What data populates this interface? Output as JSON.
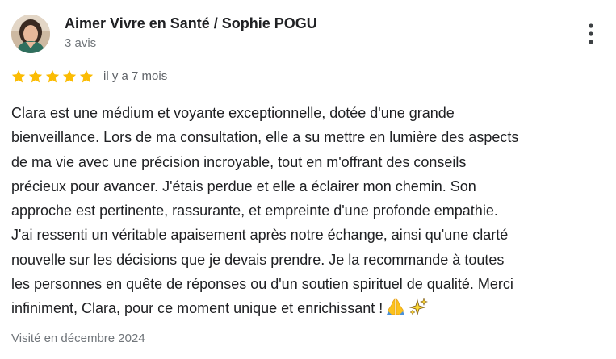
{
  "review": {
    "author": {
      "name": "Aimer Vivre en Santé / Sophie POGU",
      "review_count": "3 avis",
      "avatar_icon": "profile-photo"
    },
    "more_icon": "more-vert-icon",
    "rating": {
      "stars": 5,
      "max": 5,
      "color": "#fbbc04"
    },
    "time_ago": "il y a 7 mois",
    "text_lines": [
      "Clara est une médium et voyante exceptionnelle, dotée d'une grande",
      "bienveillance. Lors de ma consultation, elle a su mettre en lumière des aspects",
      "de ma vie avec une précision incroyable, tout en m'offrant des conseils",
      "précieux pour avancer. J'étais perdue et elle a éclairer mon chemin. Son",
      "approche est pertinente, rassurante, et empreinte d'une profonde empathie.",
      "J'ai ressenti un véritable apaisement après notre échange, ainsi qu'une clarté",
      "nouvelle sur les décisions que je devais prendre. Je la recommande à toutes",
      "les personnes en quête de réponses ou d'un soutien spirituel de qualité. Merci",
      "infiniment, Clara, pour ce moment unique et enrichissant !"
    ],
    "text_emojis": [
      "folded-hands-icon",
      "sparkles-icon"
    ],
    "visited": "Visité en décembre 2024"
  }
}
